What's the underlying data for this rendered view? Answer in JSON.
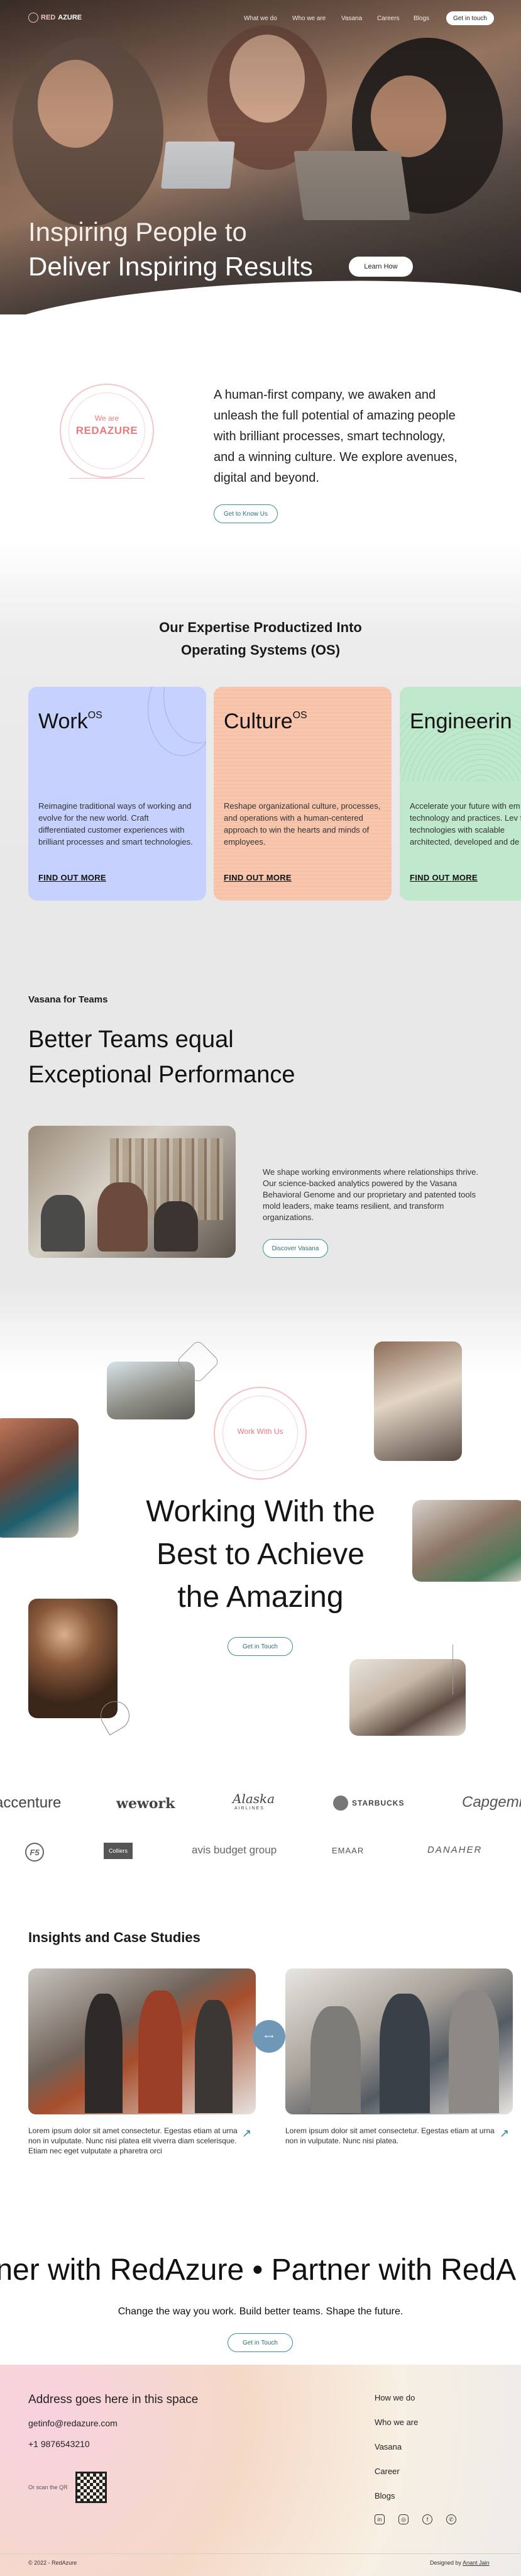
{
  "nav": {
    "brand_prefix": "RED",
    "brand_suffix": "AZURE",
    "links": [
      "What we do",
      "Who we are",
      "Vasana",
      "Careers",
      "Blogs"
    ],
    "cta": "Get in touch"
  },
  "hero": {
    "title_line1": "Inspiring People to",
    "title_line2": "Deliver Inspiring Results",
    "cta": "Learn How"
  },
  "about": {
    "badge_top": "We are",
    "badge_main": "REDAZURE",
    "text": "A human-first company, we awaken and unleash the full potential of amazing people with brilliant processes, smart technology, and a winning culture. We explore avenues, digital and beyond.",
    "cta": "Get to Know Us"
  },
  "expertise": {
    "title_line1": "Our Expertise Productized Into",
    "title_line2": "Operating Systems (OS)",
    "cards": [
      {
        "title": "Work",
        "sup": "OS",
        "desc": "Reimagine traditional ways of working and evolve for the new world. Craft differentiated customer experiences with brilliant processes and smart technologies.",
        "link": "FIND OUT MORE",
        "color": "#c6d1fd"
      },
      {
        "title": "Culture",
        "sup": "OS",
        "desc": "Reshape organizational culture, processes, and operations with a human-centered approach to win the hearts and minds of employees.",
        "link": "FIND OUT MORE",
        "color": "#f7c6ad"
      },
      {
        "title": "Engineerin",
        "sup": "",
        "desc": "Accelerate your future with em technology and practices. Lev fit technologies with scalable architected, developed and de you.",
        "link": "FIND OUT MORE",
        "color": "#bfe8cc"
      }
    ]
  },
  "vasana": {
    "eyebrow": "Vasana for Teams",
    "title_line1": "Better Teams equal",
    "title_line2": "Exceptional Performance",
    "text": "We shape working environments where relationships thrive. Our science-backed analytics powered by the Vasana Behavioral Genome and our proprietary and patented tools mold leaders, make teams resilient, and transform organizations.",
    "cta": "Discover Vasana"
  },
  "work": {
    "badge": "Work With Us",
    "title_line1": "Working With the",
    "title_line2": "Best to Achieve",
    "title_line3": "the Amazing",
    "cta": "Get in Touch"
  },
  "logos": {
    "row1": [
      "accenture",
      "wework",
      "Alaska",
      "STARBUCKS",
      "Capgemini"
    ],
    "alaska_sub": "AIRLINES",
    "row2": [
      "F5",
      "Colliers",
      "avis budget group",
      "EMAAR",
      "DANAHER"
    ]
  },
  "insights": {
    "title": "Insights and Case Studies",
    "items": [
      {
        "text": "Lorem ipsum dolor sit amet consectetur. Egestas etiam at urna non in vulputate. Nunc nisi platea elit viverra diam scelerisque. Etiam nec eget vulputate a pharetra orci"
      },
      {
        "text": "Lorem ipsum dolor sit amet consectetur. Egestas etiam at urna non in vulputate. Nunc nisi platea."
      }
    ]
  },
  "partner": {
    "marquee": "rtner with RedAzure • Partner with RedA",
    "subtitle": "Change the way you work. Build better teams. Shape the future.",
    "cta": "Get in Touch"
  },
  "footer": {
    "address": "Address goes here in this space",
    "email": "getinfo@redazure.com",
    "phone": "+1 9876543210",
    "qr_label": "Or scan the QR",
    "links": [
      "How we do",
      "Who we are",
      "Vasana",
      "Career",
      "Blogs"
    ],
    "copyright": "© 2022 - RedAzure",
    "credit_prefix": "Designed by",
    "credit_name": "Anant Jain"
  },
  "colors": {
    "brand_red": "#e87a80",
    "teal": "#3a8f9a",
    "card_work": "#c6d1fd",
    "card_culture": "#f7c6ad",
    "card_engineering": "#bfe8cc"
  }
}
